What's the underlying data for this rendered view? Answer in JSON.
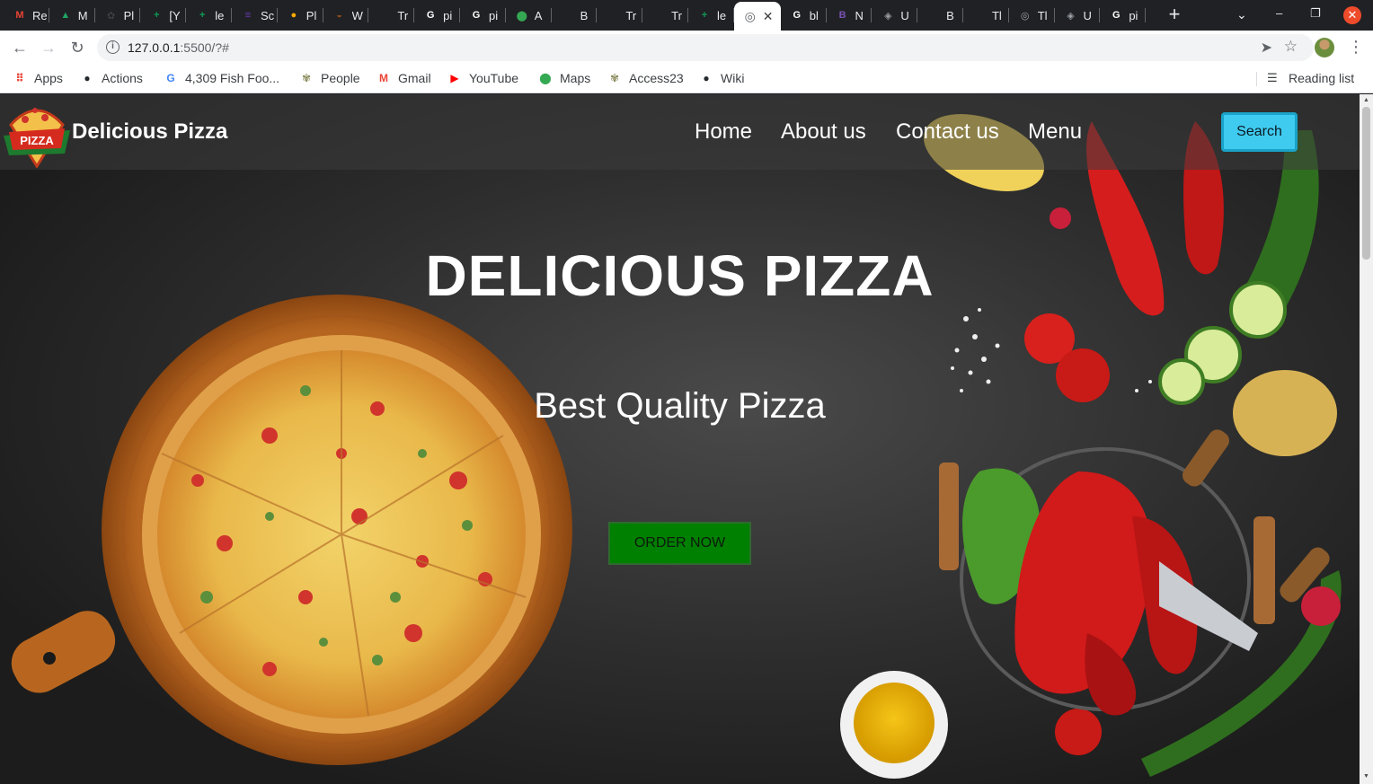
{
  "browser": {
    "tabs": [
      {
        "icon": "gmail-icon",
        "title": "Re",
        "color": "#ea4335",
        "glyph": "M"
      },
      {
        "icon": "drive-icon",
        "title": "M",
        "color": "#1fa463",
        "glyph": "▲"
      },
      {
        "icon": "plant-icon",
        "title": "Pl",
        "color": "#3c4043",
        "glyph": "✿"
      },
      {
        "icon": "sheets-icon",
        "title": "[Y",
        "color": "#0f9d58",
        "glyph": "+"
      },
      {
        "icon": "sheets-icon",
        "title": "le",
        "color": "#0f9d58",
        "glyph": "+"
      },
      {
        "icon": "forms-icon",
        "title": "Sc",
        "color": "#673ab7",
        "glyph": "≡"
      },
      {
        "icon": "circle-icon",
        "title": "Pl",
        "color": "#f9ab00",
        "glyph": "●"
      },
      {
        "icon": "pizza-icon",
        "title": "W",
        "color": "#8d4b1e",
        "glyph": "◒"
      },
      {
        "icon": "w-icon",
        "title": "Tr",
        "color": "#202124",
        "glyph": "W"
      },
      {
        "icon": "google-icon",
        "title": "pi",
        "color": "#ffffff",
        "glyph": "G"
      },
      {
        "icon": "google-icon",
        "title": "pi",
        "color": "#ffffff",
        "glyph": "G"
      },
      {
        "icon": "maps-icon",
        "title": "A",
        "color": "#34a853",
        "glyph": "⬤"
      },
      {
        "icon": "w-icon",
        "title": "B",
        "color": "#202124",
        "glyph": "W"
      },
      {
        "icon": "w-icon",
        "title": "Tr",
        "color": "#202124",
        "glyph": "W"
      },
      {
        "icon": "w-icon",
        "title": "Tr",
        "color": "#202124",
        "glyph": "W"
      },
      {
        "icon": "sheets-icon",
        "title": "le",
        "color": "#0f9d58",
        "glyph": "+"
      }
    ],
    "active_tab": {
      "icon": "globe-icon",
      "close": "✕"
    },
    "tabs_after": [
      {
        "icon": "google-icon",
        "title": "bl",
        "color": "#ffffff",
        "glyph": "G"
      },
      {
        "icon": "bootstrap-icon",
        "title": "N",
        "color": "#7952b3",
        "glyph": "B"
      },
      {
        "icon": "layers-icon",
        "title": "U",
        "color": "#9aa0a6",
        "glyph": "◈"
      },
      {
        "icon": "w-icon",
        "title": "B",
        "color": "#202124",
        "glyph": "W"
      },
      {
        "icon": "github-icon",
        "title": "Tl",
        "color": "#202124",
        "glyph": "●"
      },
      {
        "icon": "globe-icon",
        "title": "Tl",
        "color": "#9aa0a6",
        "glyph": "◎"
      },
      {
        "icon": "layers-icon",
        "title": "U",
        "color": "#9aa0a6",
        "glyph": "◈"
      },
      {
        "icon": "google-icon",
        "title": "pi",
        "color": "#ffffff",
        "glyph": "G"
      }
    ],
    "new_tab": "+",
    "url_host": "127.0.0.1",
    "url_rest": ":5500/?#",
    "bookmarks": [
      {
        "label": "Apps",
        "icon": "apps-grid-icon"
      },
      {
        "label": "Actions",
        "icon": "github-icon"
      },
      {
        "label": "4,309 Fish Foo...",
        "icon": "google-icon"
      },
      {
        "label": "People",
        "icon": "palm-icon"
      },
      {
        "label": "Gmail",
        "icon": "gmail-icon"
      },
      {
        "label": "YouTube",
        "icon": "youtube-icon"
      },
      {
        "label": "Maps",
        "icon": "maps-pin-icon"
      },
      {
        "label": "Access23",
        "icon": "palm-icon"
      },
      {
        "label": "Wiki",
        "icon": "github-icon"
      }
    ],
    "reading_list": "Reading list"
  },
  "site": {
    "logo_text": "PIZZA",
    "brand": "Delicious Pizza",
    "nav": [
      "Home",
      "About us",
      "Contact us",
      "Menu"
    ],
    "search_label": "Search",
    "hero_title": "DELICIOUS PIZZA",
    "hero_subtitle": "Best Quality Pizza",
    "cta_label": "ORDER NOW"
  },
  "colors": {
    "search_button": "#3fcbef",
    "order_button": "#008000"
  }
}
